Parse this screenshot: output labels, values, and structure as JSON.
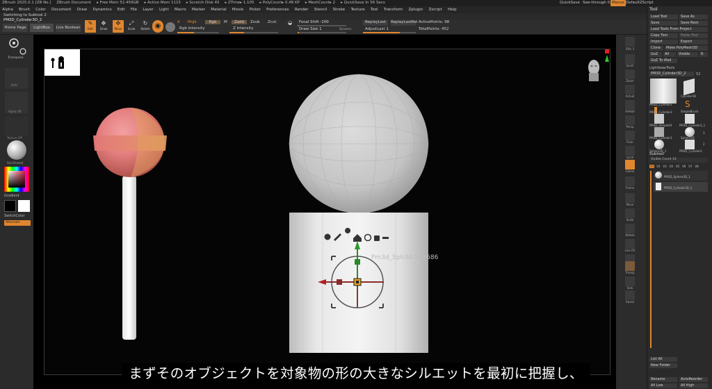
{
  "titlebar": {
    "left_items": [
      "ZBrush 2025.0.1 [ZB No.]",
      "ZBrush Document",
      "▸ Free Mem 52.459GB",
      "▸ Active Mem 1115",
      "▸ Scratch Disk 45",
      "▸ ZTime▸ 1.105",
      "▸ PolyCount▸ 0.48 KP",
      "▸ MeshCount▸ 2",
      "▸ QuickSave In 56 Secs"
    ],
    "quicksave": "QuickSave",
    "seethrough": "See-through  0",
    "menus": "Menus",
    "zscript": "DefaultZScript"
  },
  "menubar": {
    "items": [
      "Alpha",
      "Brush",
      "Color",
      "Document",
      "Draw",
      "Dynamics",
      "Edit",
      "File",
      "Layer",
      "Light",
      "Macro",
      "Marker",
      "Material",
      "Movie",
      "Picker",
      "Preferences",
      "Render",
      "Stencil",
      "Stroke",
      "Texture",
      "Tool",
      "Transform",
      "Zplugin",
      "Zscript",
      "Help"
    ]
  },
  "breadcrumb": {
    "switching": "Switching to Subtool 2",
    "current": "PM3D_Cylinder3D_2"
  },
  "toolbar": {
    "home": "Home Page",
    "lightbox": "LightBox",
    "live_boolean": "Live Boolean",
    "edit": "Edit",
    "draw": "Draw",
    "move": "Move",
    "scale": "Scale",
    "rotate": "Rotate",
    "a_label": "A",
    "mrgb": "Mrgb",
    "rgb": "Rgb",
    "m": "M",
    "zadd": "Zadd",
    "zsub": "Zsub",
    "zcut": "Zcut",
    "rgb_intensity": "Rgb Intensity",
    "z_intensity": "Z Intensity",
    "focal_shift": "Focal Shift -100",
    "draw_size": "Draw Size 1",
    "dynamic": "Dynamic",
    "replay_last": "ReplayLast",
    "replay_last_rel": "ReplayLastRel",
    "adjust_last": "AdjustLast 1",
    "active_points": "ActivePoints: 98",
    "total_points": "TotalPoints: 452"
  },
  "leftpanel": {
    "transpose": "Transpose",
    "dots": "Dots",
    "alpha_off": "Alpha Off",
    "texture_off": "Texture Off",
    "material": "SkinShade4",
    "gradient": "Gradient",
    "switch_color": "SwitchColor",
    "alternate": "Alternate"
  },
  "rightshelf": {
    "items": [
      "SPix 3",
      "Scroll",
      "Zoom",
      "Actual",
      "AAHalf",
      "Persp",
      "Floor",
      "Local",
      "Gizmo",
      "Frame",
      "Move",
      "Scale",
      "Rotate",
      "Line Fill",
      "PolyF",
      "Transp",
      "Solo",
      "Xpose"
    ]
  },
  "toolpanel": {
    "title": "Tool",
    "load_tool": "Load Tool",
    "save_as": "Save As",
    "save": "Save",
    "save_next": "Save Next",
    "load_from_project": "Load Tools From Project",
    "copy_tool": "Copy Tool",
    "paste_tool": "Paste Tool",
    "import": "Import",
    "export": "Export",
    "clone": "Clone",
    "make_polymesh": "Make PolyMesh3D",
    "goz": "GoZ",
    "all": "All",
    "visible": "Visible",
    "r": "R",
    "goz_to": "GoZ To iPad",
    "lightbox_tools": "Lightbox▸Tools",
    "current_tool": "PM3D_Cylinder3D_2",
    "current_count": "52",
    "thumbs": [
      "PM3D_Cylinder3",
      "Cylinder3D",
      "PM3D_Cylinder3",
      "SimpleBrush",
      "PM3D_Simple04",
      "PM3D_Cylinder3_1",
      "PM3D_Cylinder3",
      "Sphere3D",
      "Sphere3D_1",
      "PM3D_Cylinder3"
    ],
    "thumb_badges": [
      "3",
      "2"
    ],
    "subtool": "Subtool",
    "visible_count": "Visible Count 14",
    "versions": [
      "V1",
      "V2",
      "V3",
      "V4",
      "V5",
      "V6",
      "V7",
      "V8"
    ],
    "subtools": [
      "PM3D_Sphere3D_1",
      "PM3D_Cylinder3D_2"
    ],
    "list_all": "List All",
    "new_folder": "New Folder",
    "rename": "Rename",
    "auto_reorder": "AutoReorder",
    "all_low": "All Low",
    "all_high": "All High"
  },
  "viewport": {
    "gizmo_watermark": "Pm3d_Sph3d-707686"
  },
  "subtitle": "まずそのオブジェクトを対象物の形の大きなシルエットを最初に把握し、",
  "colors": {
    "accent": "#e0862e",
    "canvas": "#000000",
    "panel": "#2a2a2a"
  }
}
